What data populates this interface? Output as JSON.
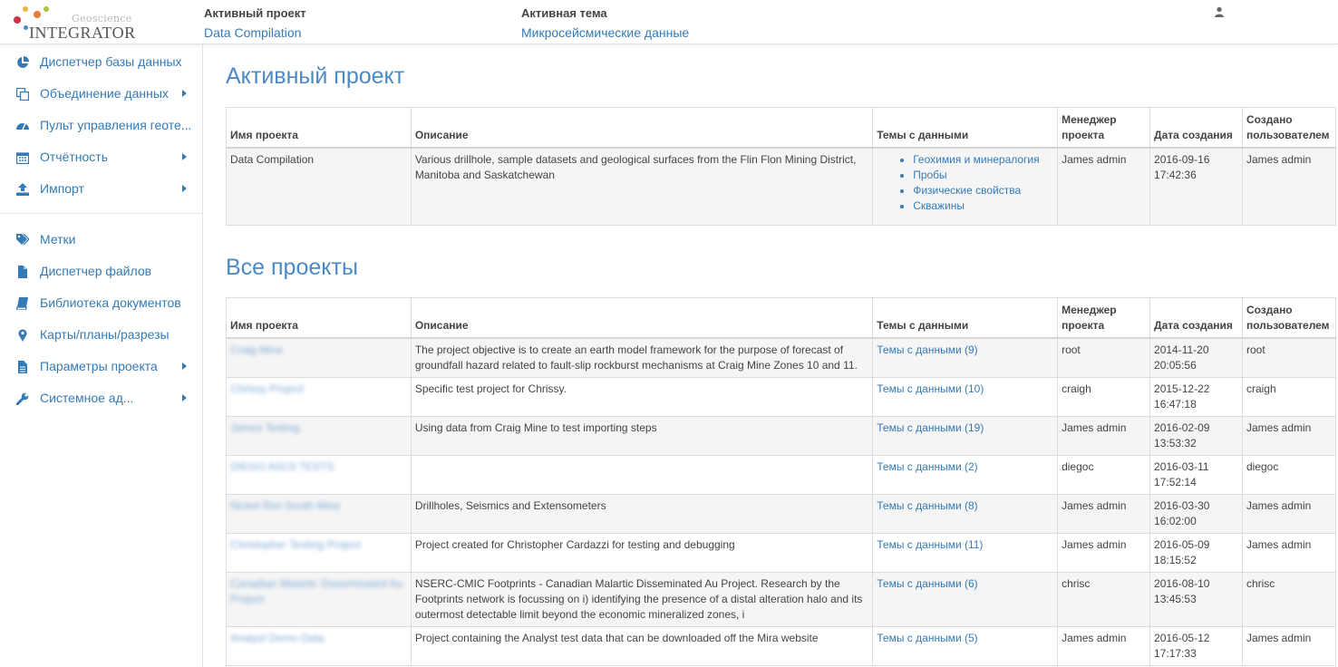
{
  "header": {
    "logo_small": "Geoscience",
    "logo_main": "INTEGRATOR",
    "active_project_label": "Активный проект",
    "active_project_value": "Data Compilation",
    "active_theme_label": "Активная тема",
    "active_theme_value": "Микросейсмические данные",
    "user_icon": "user-icon"
  },
  "sidebar": {
    "items": [
      {
        "label": "Диспетчер базы данных",
        "icon": "pie-chart-icon",
        "submenu": false
      },
      {
        "label": "Объединение данных",
        "icon": "clone-icon",
        "submenu": true
      },
      {
        "label": "Пульт управления геоте...",
        "icon": "dashboard-icon",
        "submenu": false
      },
      {
        "label": "Отчётность",
        "icon": "calendar-icon",
        "submenu": true
      },
      {
        "label": "Импорт",
        "icon": "upload-icon",
        "submenu": true
      },
      {
        "label": "Метки",
        "icon": "tags-icon",
        "submenu": false
      },
      {
        "label": "Диспетчер файлов",
        "icon": "file-icon",
        "submenu": false
      },
      {
        "label": "Библиотека документов",
        "icon": "book-icon",
        "submenu": false
      },
      {
        "label": "Карты/планы/разрезы",
        "icon": "map-marker-icon",
        "submenu": false
      },
      {
        "label": "Параметры проекта",
        "icon": "file-text-icon",
        "submenu": true
      },
      {
        "label": "Системное ад...",
        "icon": "wrench-icon",
        "submenu": true
      }
    ]
  },
  "active_section": {
    "title": "Активный проект",
    "columns": [
      "Имя проекта",
      "Описание",
      "Темы с данными",
      "Менеджер проекта",
      "Дата создания",
      "Создано пользователем"
    ],
    "row": {
      "name": "Data Compilation",
      "description": "Various drillhole, sample datasets and geological surfaces from the Flin Flon Mining District, Manitoba and Saskatchewan",
      "themes": [
        "Геохимия и минералогия",
        "Пробы",
        "Физические свойства",
        "Скважины"
      ],
      "manager": "James admin",
      "date": "2016-09-16 17:42:36",
      "created_by": "James admin"
    }
  },
  "all_section": {
    "title": "Все проекты",
    "columns": [
      "Имя проекта",
      "Описание",
      "Темы с данными",
      "Менеджер проекта",
      "Дата создания",
      "Создано пользователем"
    ],
    "rows": [
      {
        "name": "Craig Mine",
        "description": "The project objective is to create an earth model framework for the purpose of forecast of groundfall hazard related to fault-slip rockburst mechanisms at Craig Mine Zones 10 and 11.",
        "themes": "Темы с данными (9)",
        "manager": "root",
        "date": "2014-11-20 20:05:56",
        "created_by": "root"
      },
      {
        "name": "Chrissy Project",
        "description": "Specific test project for Chrissy.",
        "themes": "Темы с данными (10)",
        "manager": "craigh",
        "date": "2015-12-22 16:47:18",
        "created_by": "craigh"
      },
      {
        "name": "James Testing",
        "description": "Using data from Craig Mine to test importing steps",
        "themes": "Темы с данными (19)",
        "manager": "James admin",
        "date": "2016-02-09 13:53:32",
        "created_by": "James admin"
      },
      {
        "name": "DIEGO ASCII TESTS",
        "description": "",
        "themes": "Темы с данными (2)",
        "manager": "diegoc",
        "date": "2016-03-11 17:52:14",
        "created_by": "diegoc"
      },
      {
        "name": "Nickel Rim South Mine",
        "description": "Drillholes, Seismics and Extensometers",
        "themes": "Темы с данными (8)",
        "manager": "James admin",
        "date": "2016-03-30 16:02:00",
        "created_by": "James admin"
      },
      {
        "name": "Christopher Testing Project",
        "description": "Project created for Christopher Cardazzi for testing and debugging",
        "themes": "Темы с данными (11)",
        "manager": "James admin",
        "date": "2016-05-09 18:15:52",
        "created_by": "James admin"
      },
      {
        "name": "Canadian Malartic Disseminated Au Project",
        "description": "NSERC-CMIC Footprints - Canadian Malartic Disseminated Au Project. Research by the Footprints network is focussing on i) identifying the presence of a distal alteration halo and its outermost detectable limit beyond the economic mineralized zones, i",
        "themes": "Темы с данными (6)",
        "manager": "chrisc",
        "date": "2016-08-10 13:45:53",
        "created_by": "chrisc"
      },
      {
        "name": "Analyst Demo Data",
        "description": "Project containing the Analyst test data that can be downloaded off the Mira website",
        "themes": "Темы с данными (5)",
        "manager": "James admin",
        "date": "2016-05-12 17:17:33",
        "created_by": "James admin"
      }
    ]
  },
  "colors": {
    "link": "#337ab7",
    "heading": "#4a8ac6",
    "stripe": "#f5f5f5",
    "border": "#dcdcdc"
  }
}
